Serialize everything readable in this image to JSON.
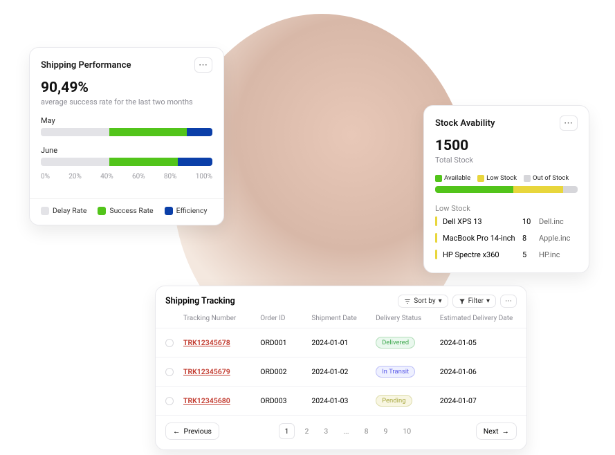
{
  "perf": {
    "title": "Shipping Performance",
    "value": "90,49%",
    "subtitle": "average success rate for the last two months",
    "months": [
      {
        "label": "May",
        "delay": 40,
        "success": 45,
        "efficiency": 15
      },
      {
        "label": "June",
        "delay": 40,
        "success": 40,
        "efficiency": 20
      }
    ],
    "ticks": [
      "0%",
      "20%",
      "40%",
      "60%",
      "80%",
      "100%"
    ],
    "legend": [
      {
        "label": "Delay Rate",
        "color": "#e3e3e7"
      },
      {
        "label": "Success Rate",
        "color": "#52c41a"
      },
      {
        "label": "Efficiency",
        "color": "#0b3fa8"
      }
    ]
  },
  "stock": {
    "title": "Stock Avability",
    "value": "1500",
    "subtitle": "Total Stock",
    "legend": [
      {
        "label": "Available",
        "color": "#52c41a"
      },
      {
        "label": "Low Stock",
        "color": "#e8d63c"
      },
      {
        "label": "Out of Stock",
        "color": "#d6d6da"
      }
    ],
    "segments": [
      {
        "pct": 55,
        "color": "#52c41a"
      },
      {
        "pct": 35,
        "color": "#e8d63c"
      },
      {
        "pct": 10,
        "color": "#d6d6da"
      }
    ],
    "low_title": "Low Stock",
    "low": [
      {
        "name": "Dell XPS 13",
        "qty": "10",
        "vendor": "Dell.inc"
      },
      {
        "name": "MacBook Pro 14-inch",
        "qty": "8",
        "vendor": "Apple.inc"
      },
      {
        "name": "HP Spectre x360",
        "qty": "5",
        "vendor": "HP.inc"
      }
    ]
  },
  "track": {
    "title": "Shipping Tracking",
    "sort_label": "Sort by",
    "filter_label": "Filter",
    "columns": [
      "Tracking Number",
      "Order ID",
      "Shipment Date",
      "Delivery Status",
      "Estimated Delivery Date"
    ],
    "rows": [
      {
        "tracking": "TRK12345678",
        "order": "ORD001",
        "ship": "2024-01-01",
        "status": "Delivered",
        "status_color": "#3fa84f",
        "status_bg": "#eaf8ee",
        "eta": "2024-01-05"
      },
      {
        "tracking": "TRK12345679",
        "order": "ORD002",
        "ship": "2024-01-02",
        "status": "In Transit",
        "status_color": "#5a5ae8",
        "status_bg": "#eef0ff",
        "eta": "2024-01-06"
      },
      {
        "tracking": "TRK12345680",
        "order": "ORD003",
        "ship": "2024-01-03",
        "status": "Pending",
        "status_color": "#a8a83f",
        "status_bg": "#f8f6e2",
        "eta": "2024-01-07"
      }
    ],
    "prev_label": "Previous",
    "next_label": "Next",
    "pages": [
      "1",
      "2",
      "3",
      "...",
      "8",
      "9",
      "10"
    ],
    "active_page": "1"
  },
  "chart_data": [
    {
      "type": "bar",
      "title": "Shipping Performance",
      "ylabel": "%",
      "xlim": [
        0,
        100
      ],
      "categories": [
        "May",
        "June"
      ],
      "series": [
        {
          "name": "Delay Rate",
          "values": [
            40,
            40
          ]
        },
        {
          "name": "Success Rate",
          "values": [
            45,
            40
          ]
        },
        {
          "name": "Efficiency",
          "values": [
            15,
            20
          ]
        }
      ]
    },
    {
      "type": "bar",
      "title": "Stock Avability",
      "categories": [
        "Available",
        "Low Stock",
        "Out of Stock"
      ],
      "values": [
        55,
        35,
        10
      ]
    }
  ]
}
